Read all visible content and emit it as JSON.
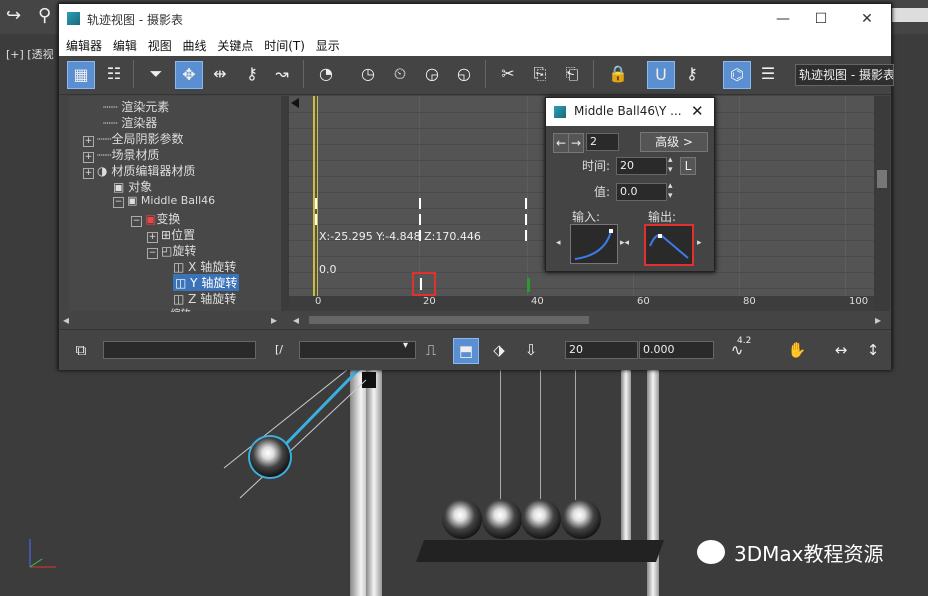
{
  "viewport": {
    "label": "[+] [透视"
  },
  "curve_editor": {
    "title": "轨迹视图 - 摄影表",
    "menu": [
      "编辑器",
      "编辑",
      "视图",
      "曲线",
      "关键点",
      "时间(T)",
      "显示"
    ],
    "toolbar_view_name": "轨迹视图 - 摄影表",
    "tree": [
      {
        "label": "渲染元素",
        "icon": "dotted-line"
      },
      {
        "label": "渲染器",
        "icon": "dotted-line"
      },
      {
        "label": "全局阴影参数",
        "icon": "expand"
      },
      {
        "label": "场景材质",
        "icon": "expand"
      },
      {
        "label": "材质编辑器材质",
        "icon": "expand"
      },
      {
        "label": "对象",
        "icon": "cube-icon"
      },
      {
        "label": "Middle Ball46",
        "icon": "cube-icon"
      },
      {
        "label": "变换",
        "icon": "transform-icon"
      },
      {
        "label": "位置",
        "icon": "position-icon"
      },
      {
        "label": "旋转",
        "icon": "rotation-icon"
      },
      {
        "label": "X 轴旋转",
        "icon": "axis-icon"
      },
      {
        "label": "Y 轴旋转",
        "icon": "axis-icon",
        "selected": true
      },
      {
        "label": "Z 轴旋转",
        "icon": "axis-icon"
      },
      {
        "label": "缩放",
        "icon": "scale-icon"
      }
    ],
    "graph": {
      "coordinate_readout": "X:-25.295 Y:-4.848 Z:170.446",
      "value_label": "0.0",
      "ruler_labels": [
        "0",
        "20",
        "40",
        "60",
        "80",
        "100"
      ]
    },
    "bottom": {
      "frame_value": "20",
      "value_field": "0.000",
      "zoom_value": "4.2"
    }
  },
  "key_info": {
    "title": "Middle Ball46\\Y ...",
    "key_number": "2",
    "advanced_label": "高级 >",
    "time_label": "时间:",
    "time_value": "20",
    "lock_label": "L",
    "value_label": "值:",
    "value_value": "0.0",
    "in_label": "输入:",
    "out_label": "输出:"
  },
  "watermark": {
    "text": "3DMax教程资源"
  }
}
